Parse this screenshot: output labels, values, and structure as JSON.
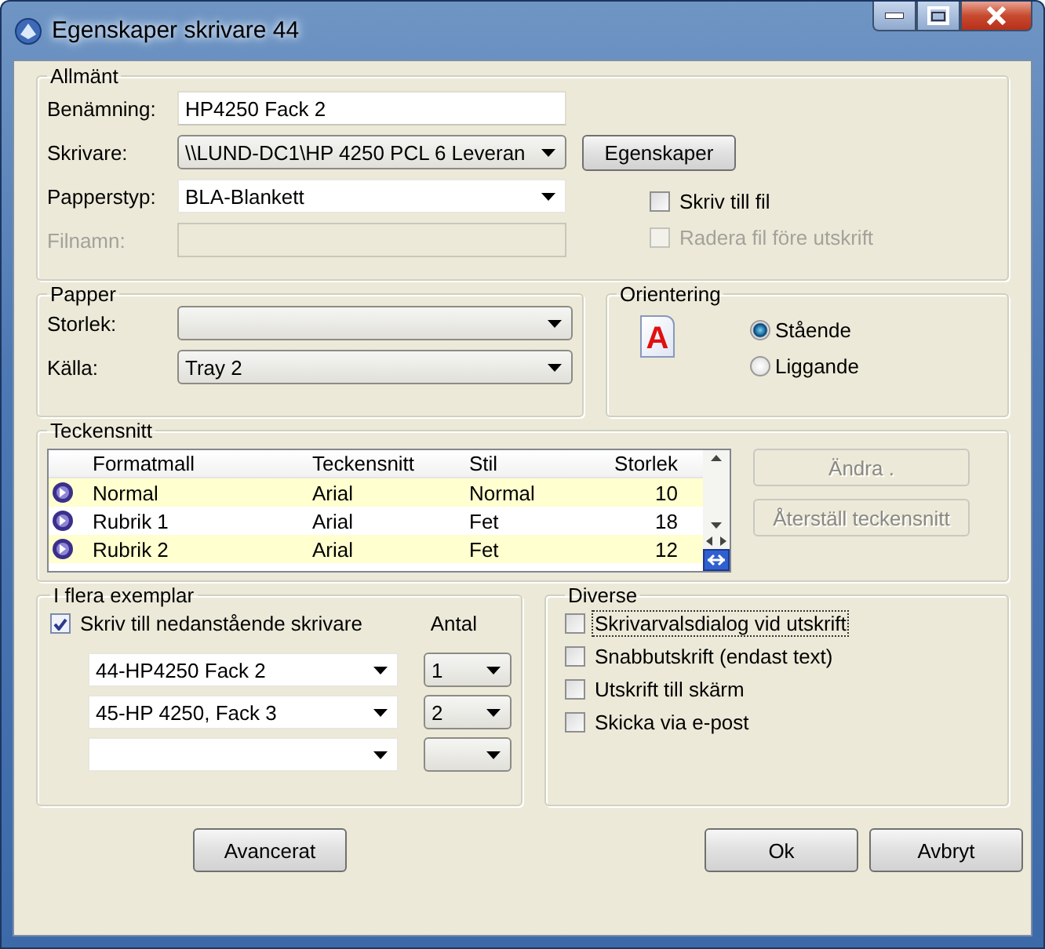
{
  "window": {
    "title": "Egenskaper skrivare 44"
  },
  "general": {
    "legend": "Allmänt",
    "fields": [
      {
        "label": "Benämning:",
        "kind": "text",
        "value": "HP4250 Fack 2"
      },
      {
        "label": "Skrivare:",
        "kind": "list",
        "value": "\\\\LUND-DC1\\HP 4250 PCL 6 Leveran"
      },
      {
        "label": "Papperstyp:",
        "kind": "combo",
        "value": "BLA-Blankett"
      },
      {
        "label": "Filnamn:",
        "kind": "text",
        "disabled": true
      }
    ],
    "properties_button": "Egenskaper",
    "options": [
      {
        "label": "Skriv till fil",
        "checked": false,
        "disabled": false
      },
      {
        "label": "Radera fil före utskrift",
        "checked": false,
        "disabled": true
      }
    ]
  },
  "paper": {
    "legend": "Papper",
    "fields": [
      {
        "label": "Storlek:",
        "kind": "list"
      },
      {
        "label": "Källa:",
        "kind": "list",
        "value": "Tray 2"
      }
    ]
  },
  "orientation": {
    "legend": "Orientering",
    "icon_letter": "A",
    "options": [
      {
        "label": "Stående",
        "selected": true
      },
      {
        "label": "Liggande",
        "selected": false
      }
    ]
  },
  "fonts": {
    "legend": "Teckensnitt",
    "columns": [
      "Formatmall",
      "Teckensnitt",
      "Stil",
      "Storlek"
    ],
    "rows": [
      {
        "cells": [
          "Normal",
          "Arial",
          "Normal",
          "10"
        ]
      },
      {
        "cells": [
          "Rubrik 1",
          "Arial",
          "Fet",
          "18"
        ]
      },
      {
        "cells": [
          "Rubrik 2",
          "Arial",
          "Fet",
          "12"
        ]
      }
    ],
    "buttons": [
      {
        "label": "Ändra .",
        "disabled": true
      },
      {
        "label": "Återställ teckensnitt",
        "disabled": true
      }
    ]
  },
  "copies": {
    "legend": "I flera exemplar",
    "enable": {
      "label": "Skriv till nedanstående skrivare",
      "checked": true
    },
    "count_header": "Antal",
    "rows": [
      {
        "printer": "44-HP4250 Fack 2",
        "count": "1"
      },
      {
        "printer": "45-HP 4250, Fack 3",
        "count": "2"
      },
      {}
    ]
  },
  "misc": {
    "legend": "Diverse",
    "options": [
      {
        "label": "Skrivarvalsdialog vid utskrift",
        "checked": false,
        "focused": true
      },
      {
        "label": "Snabbutskrift (endast text)",
        "checked": false,
        "focused": false
      },
      {
        "label": "Utskrift till skärm",
        "checked": false,
        "focused": false
      },
      {
        "label": "Skicka via e-post",
        "checked": false,
        "focused": false
      }
    ]
  },
  "buttons": [
    {
      "label": "Avancerat",
      "kind": "left"
    },
    {
      "label": "Ok",
      "kind": "right"
    },
    {
      "label": "Avbryt",
      "kind": "right"
    }
  ]
}
